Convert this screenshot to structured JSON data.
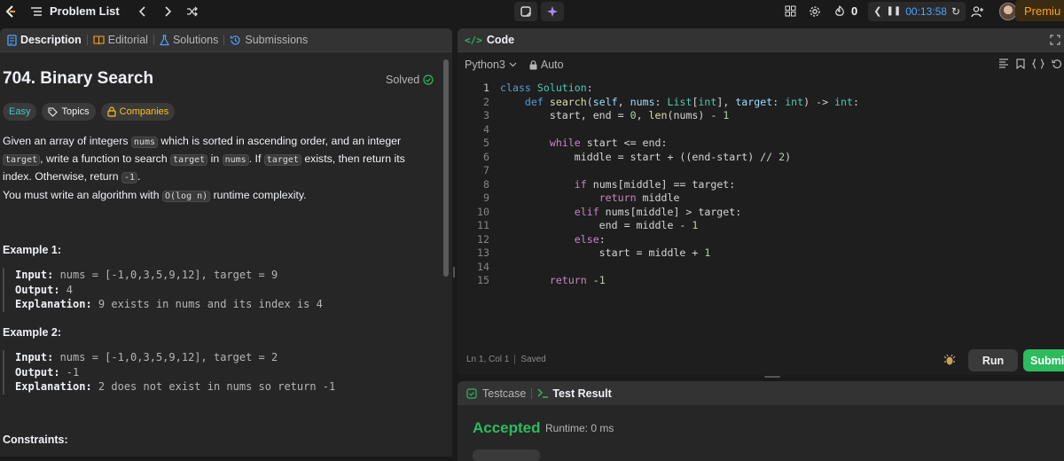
{
  "topbar": {
    "problem_list": "Problem List",
    "streak": "0",
    "timer": "00:13:58",
    "premium": "Premiu"
  },
  "left": {
    "tabs": [
      {
        "label": "Description"
      },
      {
        "label": "Editorial"
      },
      {
        "label": "Solutions"
      },
      {
        "label": "Submissions"
      }
    ],
    "title": "704. Binary Search",
    "solved": "Solved",
    "chips": {
      "difficulty": "Easy",
      "topics": "Topics",
      "companies": "Companies"
    },
    "desc": {
      "p1a": "Given an array of integers ",
      "c1": "nums",
      "p1b": " which is sorted in ascending order, and an integer ",
      "c2": "target",
      "p1c": ", write a function to search ",
      "c3": "target",
      "p1d": " in ",
      "c4": "nums",
      "p1e": ". If ",
      "c5": "target",
      "p1f": " exists, then return its index. Otherwise, return ",
      "c6": "-1",
      "p1g": ".",
      "p2a": "You must write an algorithm with ",
      "c7": "O(log n)",
      "p2b": " runtime complexity."
    },
    "examples": [
      {
        "title": "Example 1:",
        "input_label": "Input:",
        "input": " nums = [-1,0,3,5,9,12], target = 9",
        "output_label": "Output:",
        "output": " 4",
        "expl_label": "Explanation:",
        "expl": " 9 exists in nums and its index is 4"
      },
      {
        "title": "Example 2:",
        "input_label": "Input:",
        "input": " nums = [-1,0,3,5,9,12], target = 2",
        "output_label": "Output:",
        "output": " -1",
        "expl_label": "Explanation:",
        "expl": " 2 does not exist in nums so return -1"
      }
    ],
    "constraints": "Constraints:"
  },
  "editor": {
    "title": "Code",
    "language": "Python3",
    "mode": "Auto",
    "line_numbers": [
      "1",
      "2",
      "3",
      "4",
      "5",
      "6",
      "7",
      "8",
      "9",
      "10",
      "11",
      "12",
      "13",
      "14",
      "15"
    ],
    "status_pos": "Ln 1, Col 1",
    "status_saved": "Saved",
    "run": "Run",
    "submit": "Submi"
  },
  "result": {
    "tab_testcase": "Testcase",
    "tab_result": "Test Result",
    "status": "Accepted",
    "runtime": "Runtime: 0 ms"
  },
  "colors": {
    "accent_orange": "#ffa116",
    "accepted_green": "#2cbb5d",
    "easy_teal": "#46c6c2",
    "timer_blue": "#4aa3ff"
  }
}
